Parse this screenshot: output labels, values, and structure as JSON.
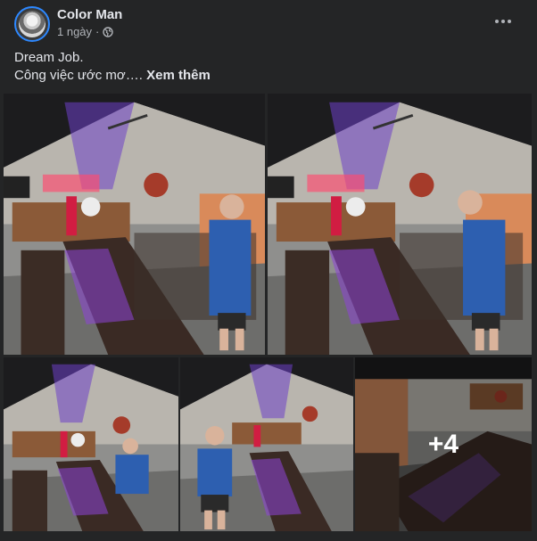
{
  "post": {
    "author": "Color Man",
    "time": "1 ngày",
    "time_separator": "·",
    "privacy_icon": "globe-icon",
    "menu_icon": "more-options-icon",
    "text_line1": "Dream Job.",
    "text_line2": "Công việc ước mơ….",
    "see_more": "Xem thêm"
  },
  "photos": {
    "count_overlay": "+4"
  }
}
